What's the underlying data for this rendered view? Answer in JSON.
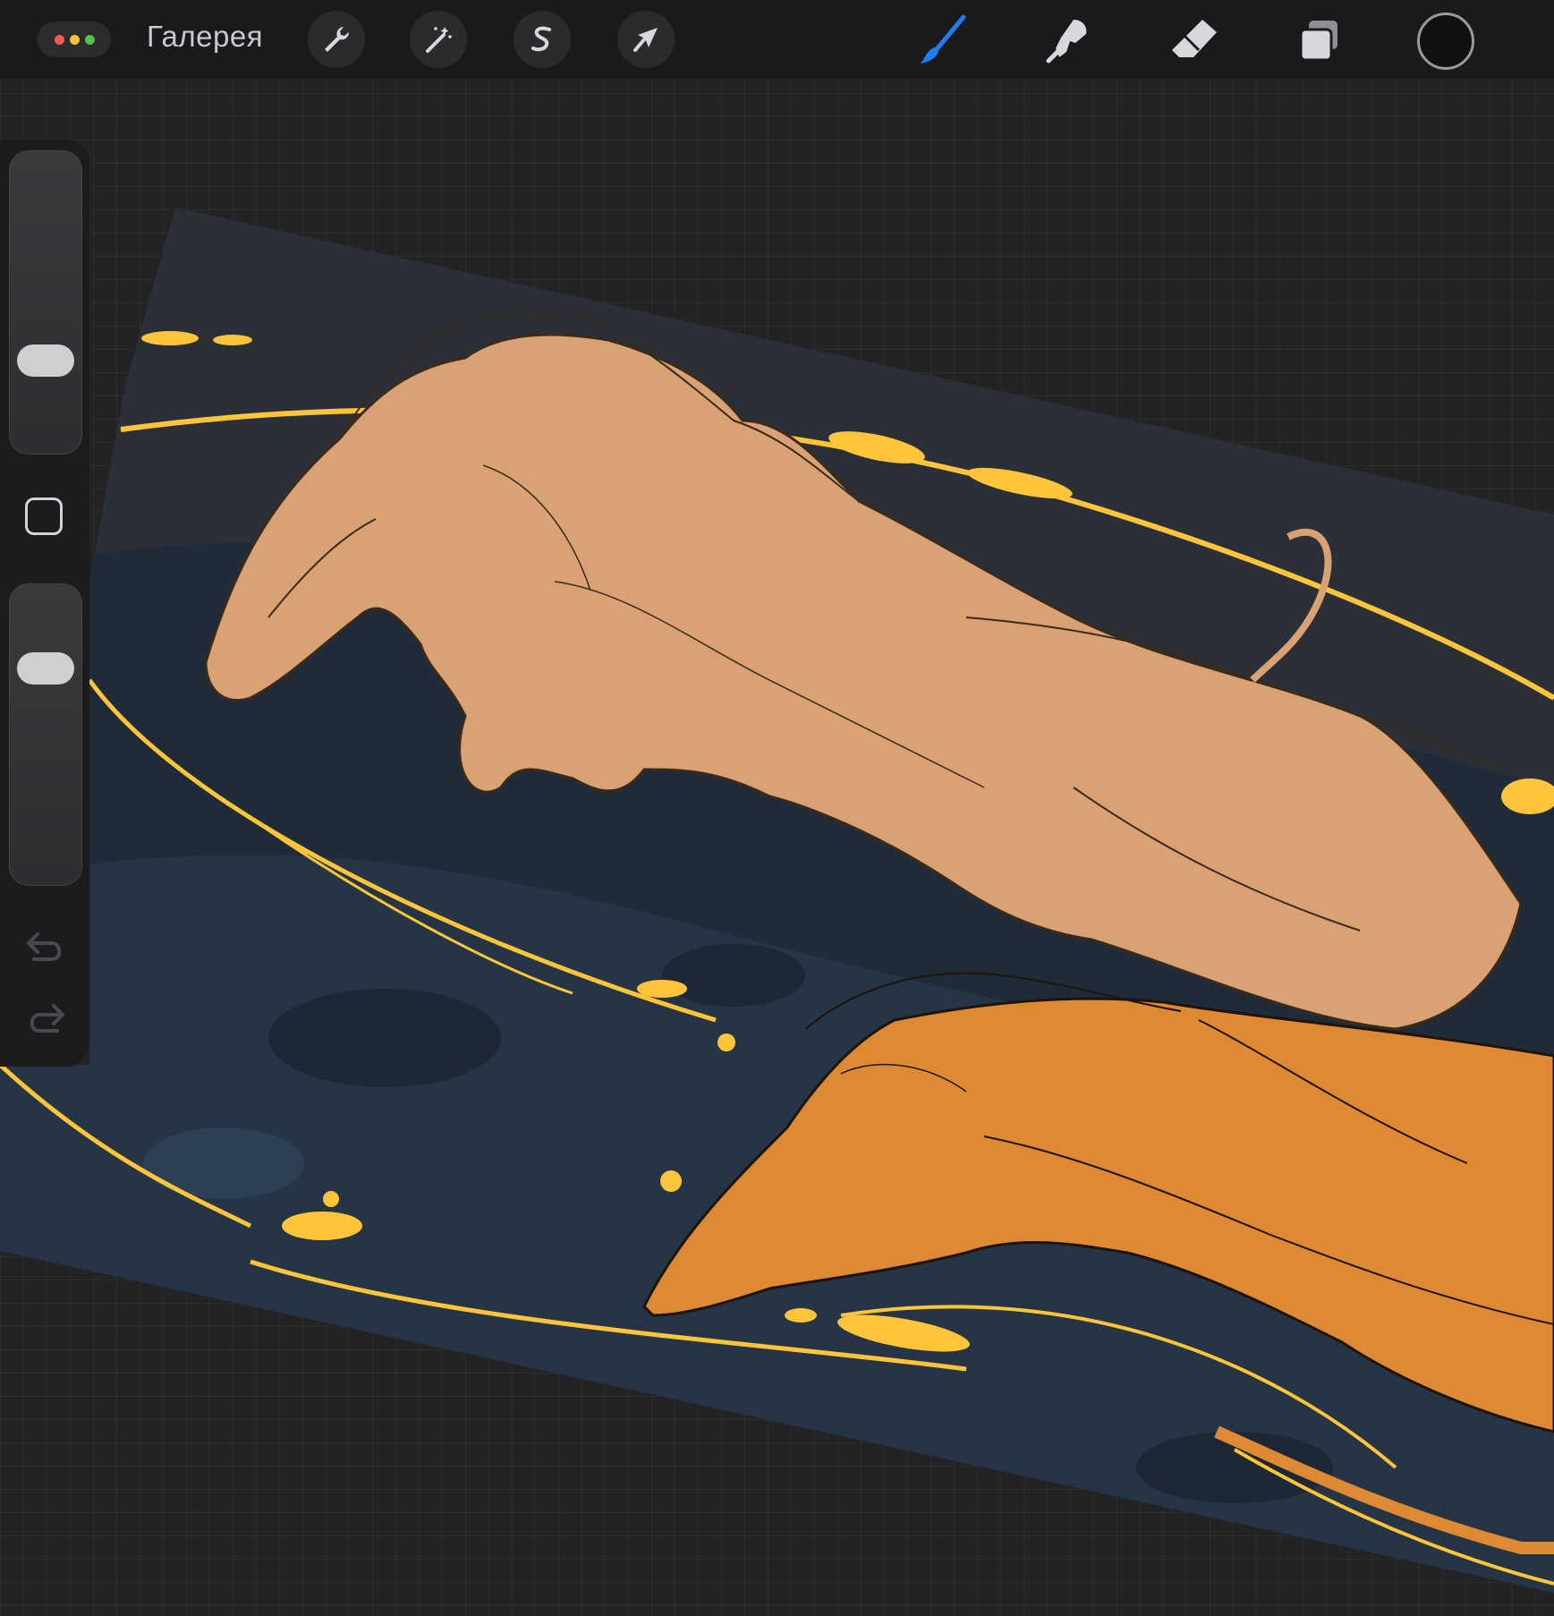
{
  "topbar": {
    "gallery_label": "Галерея",
    "left_tools": [
      "wrench-icon",
      "magic-wand-icon",
      "selection-s-icon",
      "transform-arrow-icon"
    ],
    "right_tools": [
      "brush-icon",
      "smudge-icon",
      "eraser-icon",
      "layers-icon"
    ],
    "active_tool": "brush-icon",
    "current_color": "#111111",
    "accent_color": "#1f7cf5"
  },
  "sidebar": {
    "brush_size_level": 0.3,
    "opacity_level": 0.3,
    "controls": [
      "brush-size-slider",
      "modify-button",
      "opacity-slider",
      "undo-icon",
      "redo-icon"
    ]
  },
  "canvas": {
    "background_color": "#26303c",
    "accent_color": "#ffc53a",
    "subjects": [
      "horse",
      "dragon"
    ]
  }
}
